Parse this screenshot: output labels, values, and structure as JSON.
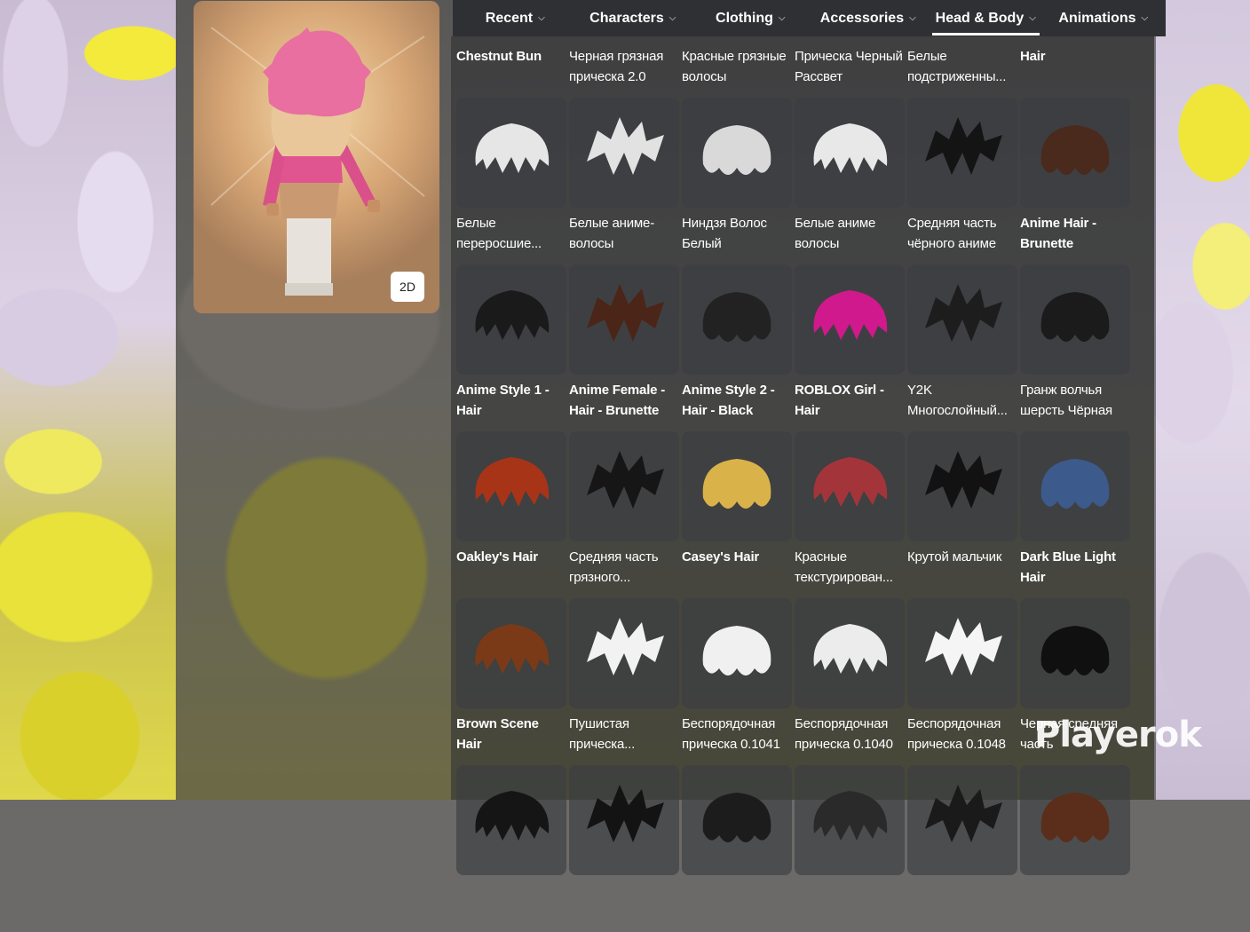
{
  "nav": {
    "tabs": [
      {
        "label": "Recent",
        "active": false
      },
      {
        "label": "Characters",
        "active": false
      },
      {
        "label": "Clothing",
        "active": false
      },
      {
        "label": "Accessories",
        "active": false
      },
      {
        "label": "Head & Body",
        "active": true
      },
      {
        "label": "Animations",
        "active": false
      }
    ]
  },
  "avatar": {
    "view_toggle": "2D"
  },
  "top_row": [
    {
      "name": "Chestnut Bun",
      "bold": true
    },
    {
      "name": "Черная грязная прическа 2.0",
      "bold": false
    },
    {
      "name": "Красные грязные волосы",
      "bold": false
    },
    {
      "name": "Прическа Черный Рассвет",
      "bold": false
    },
    {
      "name": "Белые подстриженны...",
      "bold": false
    },
    {
      "name": "Hair",
      "bold": true
    }
  ],
  "items": [
    {
      "name": "Белые переросшие...",
      "bold": false,
      "color": "#e6e6e6"
    },
    {
      "name": "Белые аниме-волосы",
      "bold": false,
      "color": "#e2e2e2"
    },
    {
      "name": "Ниндзя Волос Белый",
      "bold": false,
      "color": "#d9d9d9"
    },
    {
      "name": "Белые аниме волосы",
      "bold": false,
      "color": "#e8e8e8"
    },
    {
      "name": "Средняя часть чёрного аниме",
      "bold": false,
      "color": "#141414"
    },
    {
      "name": "Anime Hair - Brunette",
      "bold": true,
      "color": "#4a2a1c"
    },
    {
      "name": "Anime Style 1 - Hair",
      "bold": true,
      "color": "#1a1a1a"
    },
    {
      "name": "Anime Female - Hair - Brunette",
      "bold": true,
      "color": "#4b2517"
    },
    {
      "name": "Anime Style 2 - Hair - Black",
      "bold": true,
      "color": "#222222"
    },
    {
      "name": "ROBLOX Girl - Hair",
      "bold": true,
      "color": "#d0198c"
    },
    {
      "name": "Y2K Многослойный...",
      "bold": false,
      "color": "#1d1d1d"
    },
    {
      "name": "Гранж волчья шерсть Чёрная",
      "bold": false,
      "color": "#1b1b1b"
    },
    {
      "name": "Oakley's Hair",
      "bold": true,
      "color": "#a83418"
    },
    {
      "name": "Средняя часть грязного...",
      "bold": false,
      "color": "#161616"
    },
    {
      "name": "Casey's Hair",
      "bold": true,
      "color": "#d9b24a"
    },
    {
      "name": "Красные текстурирован...",
      "bold": false,
      "color": "#a3353a"
    },
    {
      "name": "Крутой мальчик",
      "bold": false,
      "color": "#121212"
    },
    {
      "name": "Dark Blue Light Hair",
      "bold": true,
      "color": "#3d5a8c"
    },
    {
      "name": "Brown Scene Hair",
      "bold": true,
      "color": "#7a3a18"
    },
    {
      "name": "Пушистая прическа...",
      "bold": false,
      "color": "#f2f2f2"
    },
    {
      "name": "Беспорядочная прическа 0.1041",
      "bold": false,
      "color": "#f0f0f0"
    },
    {
      "name": "Беспорядочная прическа 0.1040",
      "bold": false,
      "color": "#ececec"
    },
    {
      "name": "Беспорядочная прическа 0.1048",
      "bold": false,
      "color": "#f5f5f5"
    },
    {
      "name": "Черная средняя часть",
      "bold": false,
      "color": "#101010"
    },
    {
      "name": "",
      "bold": false,
      "color": "#151515"
    },
    {
      "name": "",
      "bold": false,
      "color": "#131313"
    },
    {
      "name": "",
      "bold": false,
      "color": "#1c1c1c"
    },
    {
      "name": "",
      "bold": false,
      "color": "#2a2a2a"
    },
    {
      "name": "",
      "bold": false,
      "color": "#1a1a1a"
    },
    {
      "name": "",
      "bold": false,
      "color": "#5a2e1a"
    }
  ],
  "watermark": "Playerok"
}
